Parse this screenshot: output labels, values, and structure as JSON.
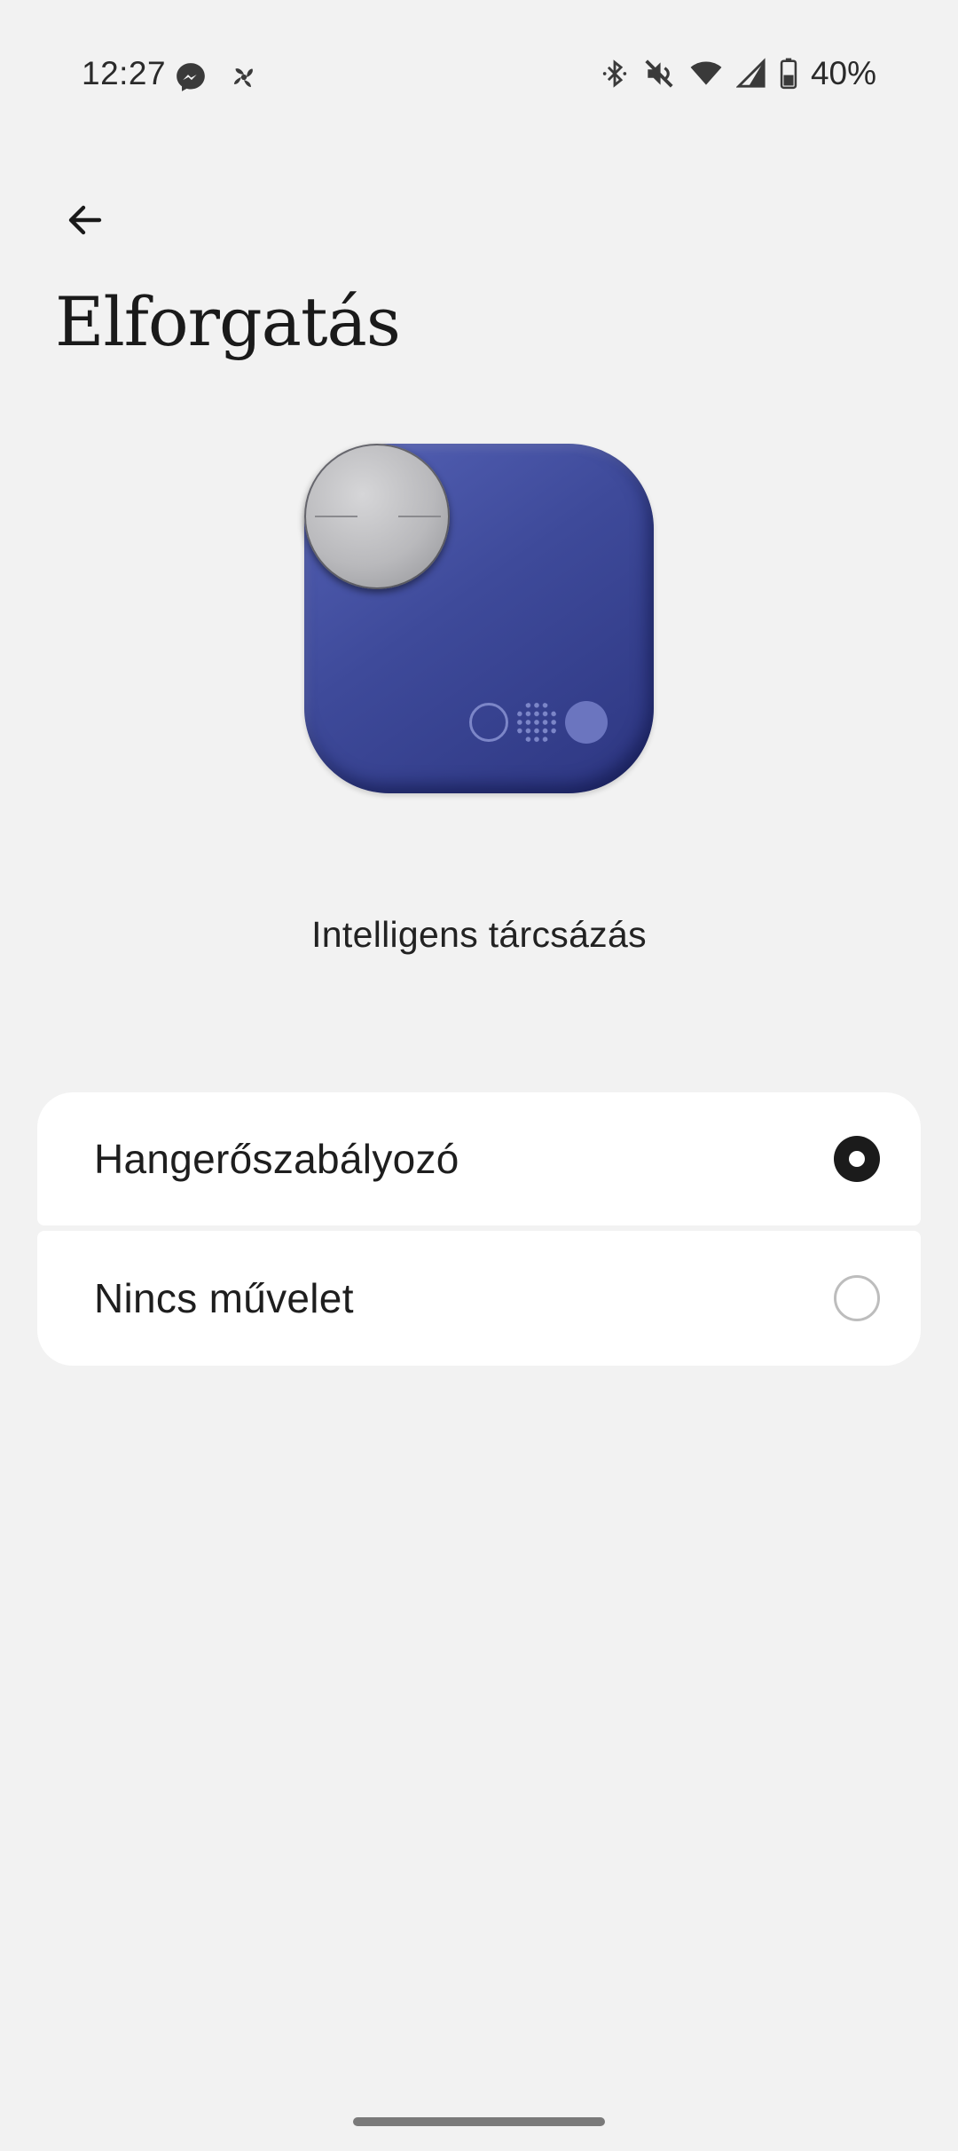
{
  "status_bar": {
    "time": "12:27",
    "left_icons": [
      "messenger-icon",
      "pinwheel-icon"
    ],
    "right_icons": [
      "bluetooth-icon",
      "volume-mute-icon",
      "wifi-icon",
      "cell-signal-icon",
      "battery-icon"
    ],
    "battery_percent": "40%"
  },
  "header": {
    "back_icon": "arrow-left-icon",
    "title": "Elforgatás"
  },
  "device": {
    "name": "Intelligens tárcsázás",
    "color": "#3e4a9a"
  },
  "options": [
    {
      "label": "Hangerőszabályozó",
      "selected": true
    },
    {
      "label": "Nincs művelet",
      "selected": false
    }
  ]
}
